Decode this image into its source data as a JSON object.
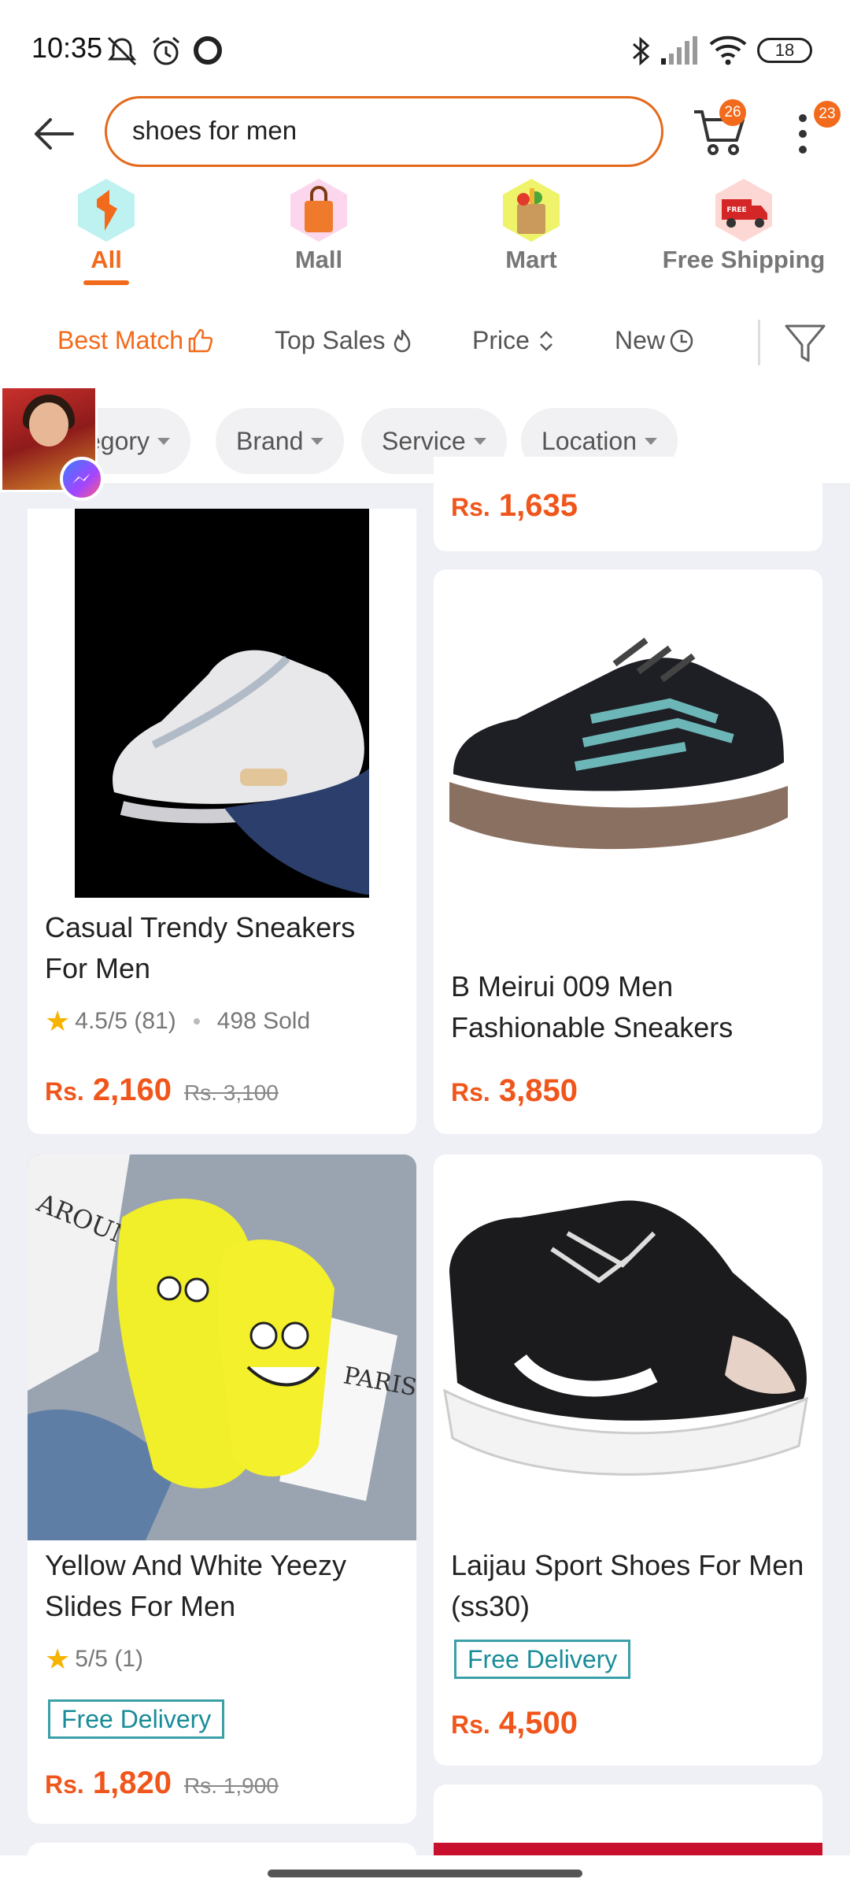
{
  "status_bar": {
    "time": "10:35",
    "battery": "18"
  },
  "search": {
    "value": "shoes for men",
    "cart_count": "26",
    "menu_count": "23"
  },
  "category_tabs": [
    {
      "label": "All",
      "icon": "all-icon",
      "active": true
    },
    {
      "label": "Mall",
      "icon": "mall-bag-icon",
      "active": false
    },
    {
      "label": "Mart",
      "icon": "mart-grocery-icon",
      "active": false
    },
    {
      "label": "Free Shipping",
      "icon": "free-shipping-truck-icon",
      "active": false
    }
  ],
  "sort_options": [
    {
      "label": "Best Match",
      "icon": "thumbs-up-icon",
      "active": true
    },
    {
      "label": "Top Sales",
      "icon": "flame-icon",
      "active": false
    },
    {
      "label": "Price",
      "icon": "sort-arrows-icon",
      "active": false
    },
    {
      "label": "New",
      "icon": "clock-icon",
      "active": false
    }
  ],
  "filter_chips": [
    {
      "label": "egory"
    },
    {
      "label": "Brand"
    },
    {
      "label": "Service"
    },
    {
      "label": "Location"
    }
  ],
  "products": {
    "partial_top_right": {
      "price_rs": "Rs.",
      "price": "1,635"
    },
    "p1": {
      "title": "Casual Trendy Sneakers For Men",
      "rating": "4.5/5 (81)",
      "sold": "498 Sold",
      "price_rs": "Rs.",
      "price": "2,160",
      "old_price": "Rs. 3,100"
    },
    "p2": {
      "title": "B Meirui 009 Men Fashionable Sneakers",
      "price_rs": "Rs.",
      "price": "3,850"
    },
    "p3": {
      "title": "Yellow And White Yeezy Slides For Men",
      "rating": "5/5 (1)",
      "badge": "Free Delivery",
      "price_rs": "Rs.",
      "price": "1,820",
      "old_price": "Rs. 1,900"
    },
    "p4": {
      "title": "Laijau Sport Shoes For Men (ss30)",
      "badge": "Free Delivery",
      "price_rs": "Rs.",
      "price": "4,500"
    }
  },
  "colors": {
    "accent": "#f26a1b",
    "price": "#f0561b",
    "free_delivery": "#188c98"
  }
}
